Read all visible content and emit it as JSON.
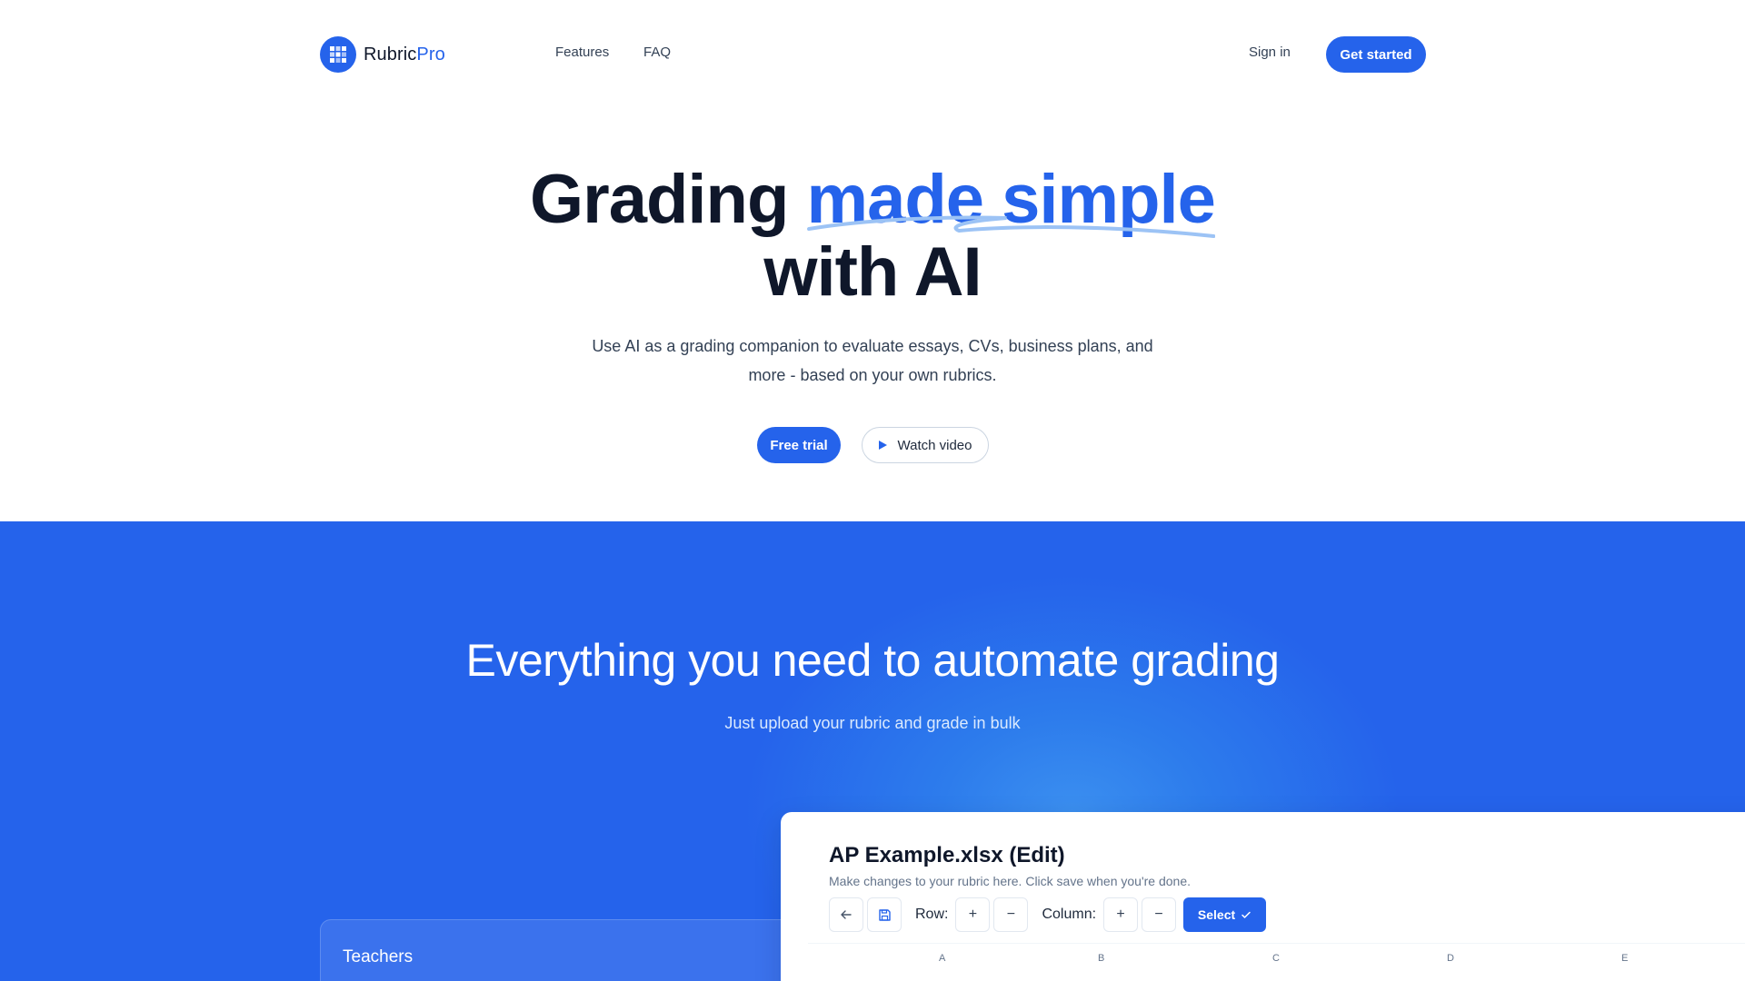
{
  "header": {
    "brand_main": "Rubric",
    "brand_accent": "Pro",
    "nav": {
      "features": "Features",
      "faq": "FAQ",
      "sign_in": "Sign in",
      "get_started": "Get started"
    }
  },
  "hero": {
    "title_part1": "Grading ",
    "title_highlight": "made simple",
    "title_line2": "with AI",
    "subtitle": "Use AI as a grading companion to evaluate essays, CVs, business plans, and more - based on your own rubrics.",
    "cta_primary": "Free trial",
    "cta_secondary": "Watch video"
  },
  "features": {
    "title": "Everything you need to automate grading",
    "subtitle": "Just upload your rubric and grade in bulk",
    "audience_card": "Teachers"
  },
  "editor": {
    "title": "AP Example.xlsx (Edit)",
    "description": "Make changes to your rubric here. Click save when you're done.",
    "row_label": "Row:",
    "column_label": "Column:",
    "select_label": "Select",
    "plus": "+",
    "minus": "−",
    "columns": [
      "A",
      "B",
      "C",
      "D",
      "E"
    ]
  },
  "colors": {
    "primary": "#2563eb",
    "text_dark": "#0f172a",
    "text_muted": "#334155"
  },
  "icons": {
    "logo": "grid-logo-icon",
    "play": "play-icon",
    "back": "arrow-left-icon",
    "save": "save-icon",
    "check": "check-icon"
  }
}
